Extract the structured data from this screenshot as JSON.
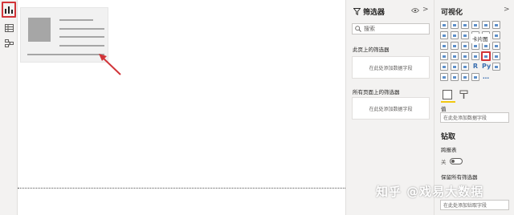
{
  "filters": {
    "title": "筛选器",
    "search_placeholder": "搜索",
    "page_section": "此页上的筛选器",
    "page_dropzone": "在此处添加数据字段",
    "all_section": "所有页面上的筛选器",
    "all_dropzone": "在此处添加数据字段"
  },
  "visualizations": {
    "title": "可视化",
    "selected_tooltip": "卡片图",
    "value_label": "值",
    "value_dropzone": "在此处添加数据字段",
    "drill_title": "钻取",
    "cross_report_label": "跨报表",
    "toggle_state": "关",
    "keep_filters_label": "保留所有筛选器",
    "drill_dropzone": "在此处添加钻取字段"
  },
  "watermark": "知乎 @戏易大数据",
  "colors": {
    "accent_red": "#d13438",
    "accent_yellow": "#f2c811",
    "pane_bg": "#f3f2f1"
  }
}
